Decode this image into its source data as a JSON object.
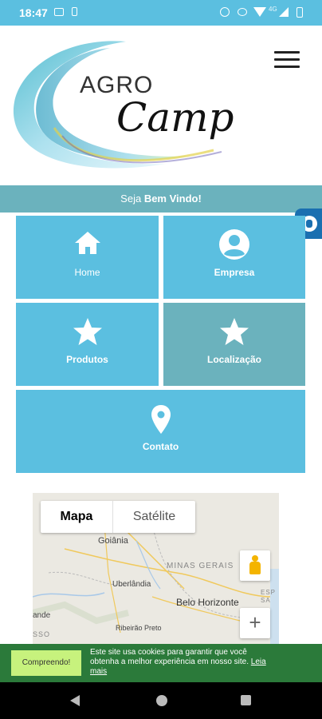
{
  "status_bar": {
    "time": "18:47",
    "network": "4G"
  },
  "header": {
    "logo_top": "AGRO",
    "logo_bottom": "Camp",
    "menu_icon": "hamburger-menu-icon"
  },
  "welcome": {
    "prefix": "Seja ",
    "highlight": "Bem Vindo!"
  },
  "tiles": [
    {
      "label": "Home",
      "icon": "home-icon"
    },
    {
      "label": "Empresa",
      "icon": "user-circle-icon"
    },
    {
      "label": "Produtos",
      "icon": "star-icon"
    },
    {
      "label": "Localização",
      "icon": "star-icon"
    },
    {
      "label": "Contato",
      "icon": "map-pin-icon"
    }
  ],
  "map": {
    "tab_map": "Mapa",
    "tab_satellite": "Satélite",
    "labels": {
      "goiania": "Goiânia",
      "minas_gerais": "MINAS GERAIS",
      "uberlandia": "Uberlândia",
      "belo_horizonte": "Belo Horizonte",
      "ribeirao_preto": "Ribeirão Preto",
      "left_edge": "ande",
      "left_edge2": "SSO",
      "right_edge": "ESP SA"
    },
    "zoom_in": "+"
  },
  "cookie": {
    "button": "Compreendo!",
    "text": "Este site usa cookies para garantir que você obtenha a melhor experiência em nosso site.",
    "link": "Leia mais"
  },
  "colors": {
    "primary": "#5bbfe0",
    "teal": "#6bb2bd",
    "cookie_bg": "#2b7a3a",
    "cookie_button": "#c7f27d"
  }
}
